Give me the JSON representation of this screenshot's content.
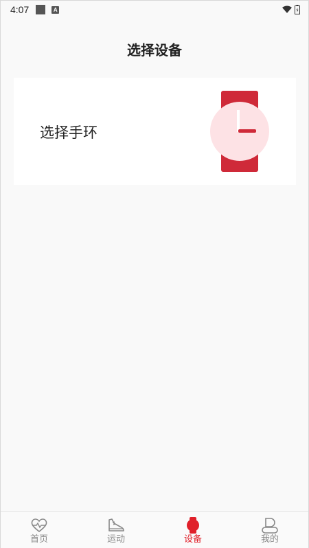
{
  "status_bar": {
    "time": "4:07",
    "a_badge": "A"
  },
  "header": {
    "title": "选择设备"
  },
  "device_card": {
    "label": "选择手环",
    "icon": "watch-icon",
    "strap_color": "#cf2a39",
    "face_color": "#fde2e5"
  },
  "bottom_nav": {
    "active_color": "#e0202a",
    "items": [
      {
        "label": "首页",
        "icon": "heart-pulse-icon"
      },
      {
        "label": "运动",
        "icon": "shoe-icon"
      },
      {
        "label": "设备",
        "icon": "watch-icon"
      },
      {
        "label": "我的",
        "icon": "user-icon"
      }
    ]
  }
}
